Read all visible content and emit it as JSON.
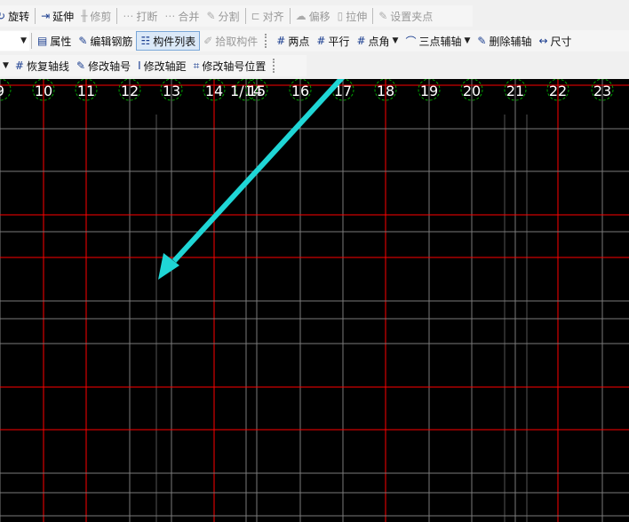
{
  "toolbar1": [
    {
      "label": "旋转",
      "icon": "rotate-icon",
      "enabled": true
    },
    {
      "label": "延伸",
      "icon": "extend-icon",
      "enabled": true
    },
    {
      "label": "修剪",
      "icon": "trim-icon",
      "enabled": false
    },
    {
      "label": "打断",
      "icon": "break-icon",
      "enabled": false
    },
    {
      "label": "合并",
      "icon": "merge-icon",
      "enabled": false
    },
    {
      "label": "分割",
      "icon": "split-icon",
      "enabled": false
    },
    {
      "label": "对齐",
      "icon": "align-icon",
      "enabled": false
    },
    {
      "label": "偏移",
      "icon": "offset-icon",
      "enabled": false
    },
    {
      "label": "拉伸",
      "icon": "stretch-icon",
      "enabled": false
    },
    {
      "label": "设置夹点",
      "icon": "grip-point-icon",
      "enabled": false
    }
  ],
  "toolbar2": [
    {
      "label": "属性",
      "icon": "properties-icon",
      "enabled": true
    },
    {
      "label": "编辑钢筋",
      "icon": "edit-rebar-icon",
      "enabled": true
    },
    {
      "label": "构件列表",
      "icon": "component-list-icon",
      "enabled": true,
      "selected": true
    },
    {
      "label": "拾取构件",
      "icon": "pick-component-icon",
      "enabled": false
    }
  ],
  "toolbar2b": [
    {
      "label": "两点",
      "icon": "two-point-icon"
    },
    {
      "label": "平行",
      "icon": "parallel-icon"
    },
    {
      "label": "点角",
      "icon": "point-angle-icon",
      "dropdown": true
    },
    {
      "label": "三点辅轴",
      "icon": "three-point-axis-icon",
      "dropdown": true
    },
    {
      "label": "删除辅轴",
      "icon": "delete-axis-icon"
    },
    {
      "label": "尺寸",
      "icon": "dimension-icon"
    }
  ],
  "toolbar3": [
    {
      "label": "恢复轴线",
      "icon": "restore-axis-icon"
    },
    {
      "label": "修改轴号",
      "icon": "edit-axis-number-icon"
    },
    {
      "label": "修改轴距",
      "icon": "edit-axis-spacing-icon"
    },
    {
      "label": "修改轴号位置",
      "icon": "edit-axis-label-position-icon"
    }
  ],
  "axes": [
    "9",
    "10",
    "11",
    "12",
    "13",
    "14",
    "1/14",
    "15",
    "16",
    "17",
    "18",
    "19",
    "20",
    "21",
    "22",
    "23"
  ],
  "colors": {
    "grid_major": "#ff0000",
    "grid_minor": "#7a7a7a",
    "axis_circle": "#00a000",
    "arrow": "#1fd6d6",
    "canvas": "#000000"
  }
}
